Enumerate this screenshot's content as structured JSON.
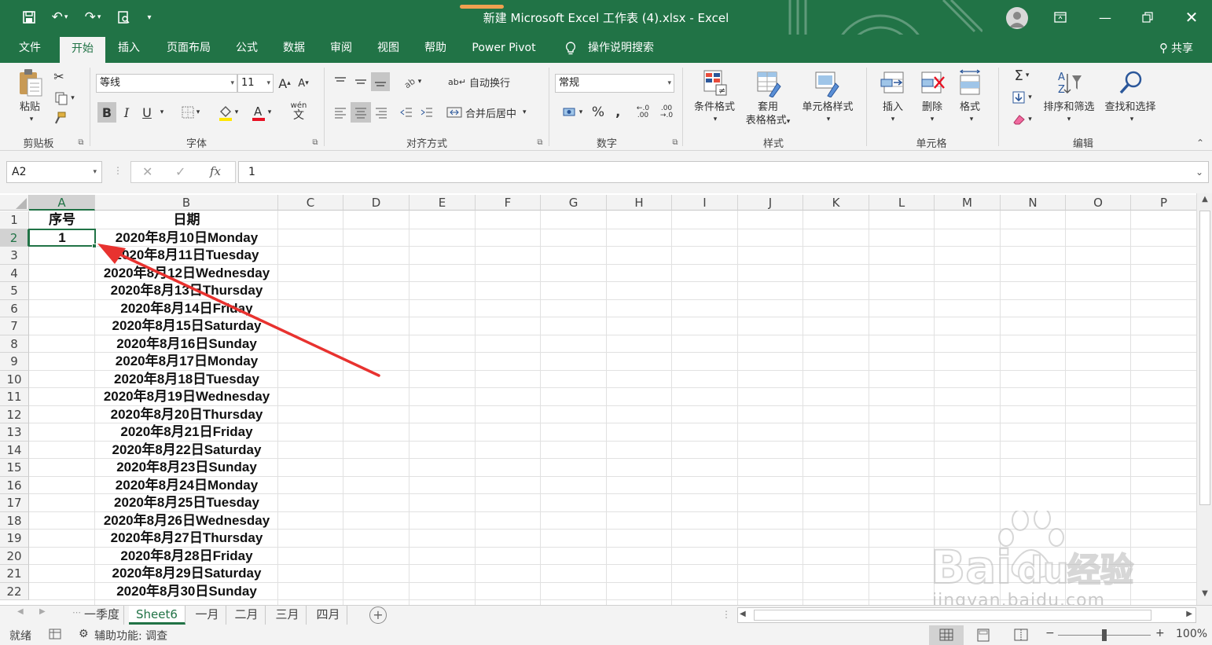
{
  "titlebar": {
    "title": "新建 Microsoft Excel 工作表 (4).xlsx  -  Excel"
  },
  "ribbon_tabs": [
    "文件",
    "开始",
    "插入",
    "页面布局",
    "公式",
    "数据",
    "审阅",
    "视图",
    "帮助",
    "Power Pivot",
    "操作说明搜索"
  ],
  "share_label": "共享",
  "ribbon": {
    "clipboard": {
      "paste": "粘贴",
      "label": "剪贴板"
    },
    "font": {
      "name": "等线",
      "size": "11",
      "bold": "B",
      "italic": "I",
      "underline": "U",
      "grow": "A",
      "shrink": "A",
      "wen": "wén",
      "label": "字体"
    },
    "alignment": {
      "wrap": "自动换行",
      "merge": "合并后居中",
      "label": "对齐方式"
    },
    "number": {
      "format": "常规",
      "percent": "%",
      "comma": "‚",
      "inc": "←.0 .00",
      "dec": ".00 →.0",
      "label": "数字"
    },
    "styles": {
      "conditional": "条件格式",
      "table1": "套用",
      "table2": "表格格式",
      "cellstyle": "单元格样式",
      "label": "样式"
    },
    "cells": {
      "insert": "插入",
      "delete": "删除",
      "format": "格式",
      "label": "单元格"
    },
    "editing": {
      "sort": "排序和筛选",
      "find": "查找和选择",
      "label": "编辑"
    }
  },
  "formula_bar": {
    "name_box": "A2",
    "value": "1",
    "fx": "fx"
  },
  "columns": [
    "A",
    "B",
    "C",
    "D",
    "E",
    "F",
    "G",
    "H",
    "I",
    "J",
    "K",
    "L",
    "M",
    "N",
    "O",
    "P"
  ],
  "rows": [
    "1",
    "2",
    "3",
    "4",
    "5",
    "6",
    "7",
    "8",
    "9",
    "10",
    "11",
    "12",
    "13",
    "14",
    "15",
    "16",
    "17",
    "18",
    "19",
    "20",
    "21",
    "22"
  ],
  "cells": {
    "A1": "序号",
    "B1": "日期",
    "A2": "1",
    "B": [
      "2020年8月10日Monday",
      "2020年8月11日Tuesday",
      "2020年8月12日Wednesday",
      "2020年8月13日Thursday",
      "2020年8月14日Friday",
      "2020年8月15日Saturday",
      "2020年8月16日Sunday",
      "2020年8月17日Monday",
      "2020年8月18日Tuesday",
      "2020年8月19日Wednesday",
      "2020年8月20日Thursday",
      "2020年8月21日Friday",
      "2020年8月22日Saturday",
      "2020年8月23日Sunday",
      "2020年8月24日Monday",
      "2020年8月25日Tuesday",
      "2020年8月26日Wednesday",
      "2020年8月27日Thursday",
      "2020年8月28日Friday",
      "2020年8月29日Saturday",
      "2020年8月30日Sunday"
    ]
  },
  "sheet_tabs": [
    "一季度",
    "Sheet6",
    "一月",
    "二月",
    "三月",
    "四月"
  ],
  "statusbar": {
    "ready": "就绪",
    "accessibility": "辅助功能: 调查",
    "zoom": "100%"
  },
  "watermark": {
    "brand": "Bai",
    "brand2": "du",
    "brand3": "经验",
    "url": "jingyan.baidu.com"
  },
  "colors": {
    "excel_green": "#217346",
    "arrow_red": "#e8322f"
  }
}
